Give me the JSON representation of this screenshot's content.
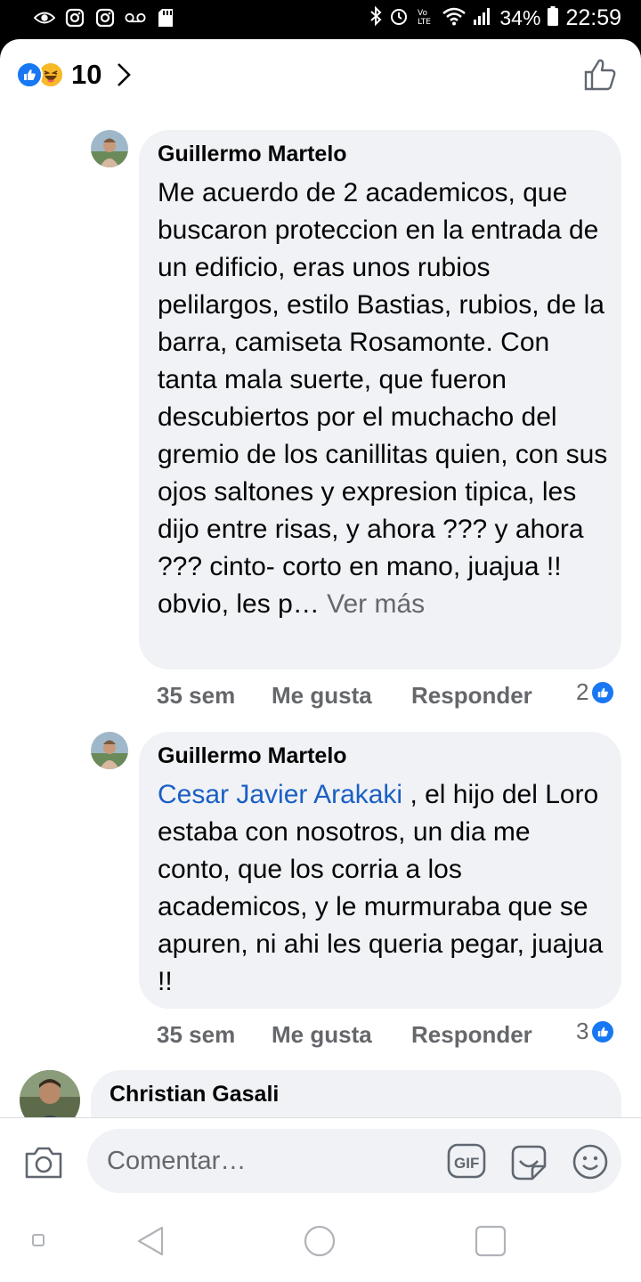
{
  "status_bar": {
    "battery": "34%",
    "time": "22:59",
    "left_icons": [
      "eye-icon",
      "instagram-icon",
      "instagram-icon",
      "voicemail-icon",
      "sd-card-icon"
    ],
    "right_icons": [
      "bluetooth-icon",
      "alarm-icon",
      "volte-icon",
      "wifi-icon",
      "signal-icon",
      "battery-icon"
    ]
  },
  "reactions": {
    "count": "10",
    "types": [
      "like",
      "haha"
    ]
  },
  "comments": [
    {
      "author": "Guillermo Martelo",
      "text": "Me acuerdo de 2 academicos, que buscaron proteccion en la entrada de un edificio, eras  unos rubios pelilargos, estilo Bastias, rubios, de la barra, camiseta Rosamonte. Con tanta mala suerte, que fueron descubiertos por el muchacho del gremio de los canillitas quien, con sus ojos saltones y expresion tipica, les dijo entre risas, y ahora ??? y ahora ??? cinto- corto en mano, juajua !! obvio, les p…",
      "see_more": "Ver más",
      "time": "35 sem",
      "like": "Me gusta",
      "reply": "Responder",
      "reaction_count": "2"
    },
    {
      "author": "Guillermo Martelo",
      "mention": "Cesar Javier Arakaki",
      "text": " , el hijo del Loro estaba con nosotros, un dia me conto, que los corria a los academicos, y le murmuraba que se apuren, ni ahi les queria pegar, juajua !!",
      "time": "35 sem",
      "like": "Me gusta",
      "reply": "Responder",
      "reaction_count": "3"
    },
    {
      "author": "Christian Gasali"
    }
  ],
  "composer": {
    "placeholder": "Comentar…",
    "icons": [
      "camera-icon",
      "gif-icon",
      "sticker-icon",
      "emoji-icon"
    ]
  },
  "nav": [
    "recents-button",
    "back-button",
    "home-button",
    "overview-button"
  ]
}
